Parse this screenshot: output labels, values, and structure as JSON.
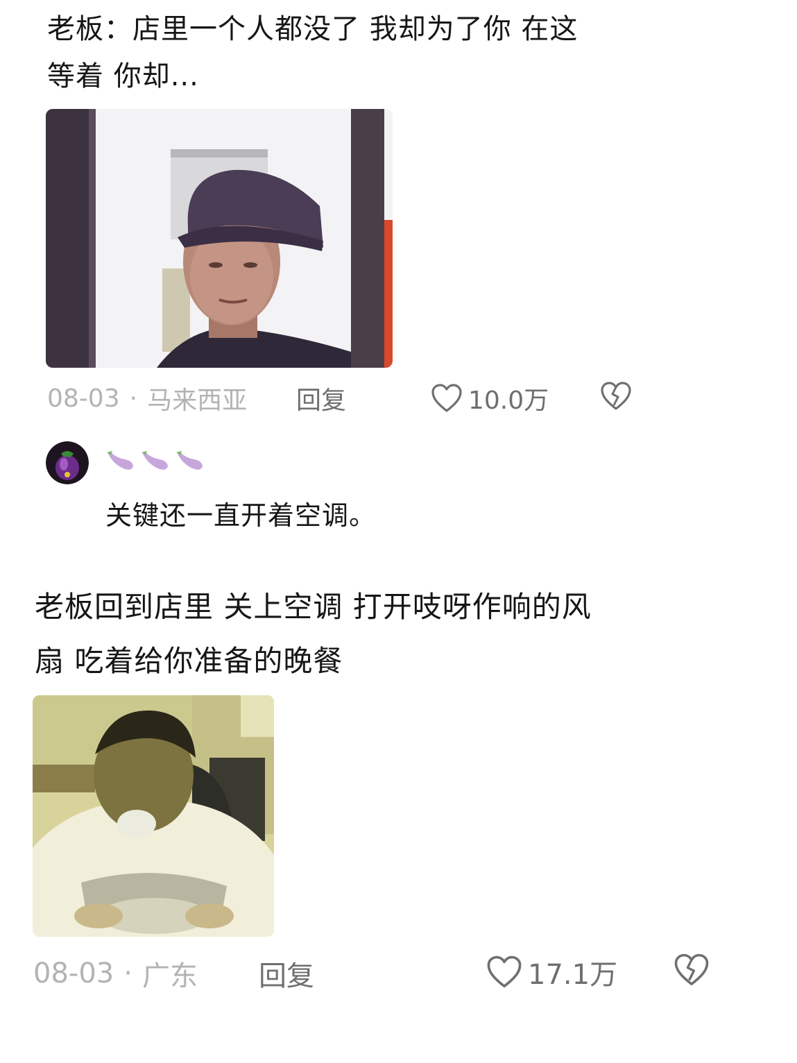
{
  "comments": [
    {
      "text_line1": "老板：店里一个人都没了 我却为了你 在这",
      "text_line2": "等着 你却...",
      "date": "08-03",
      "sep": "·",
      "location": "马来西亚",
      "reply_label": "回复",
      "likes": "10.0万",
      "reply": {
        "username_emoji": "🍆🍆🍆",
        "text": "关键还一直开着空调。"
      }
    },
    {
      "text_line1": "老板回到店里 关上空调 打开吱呀作响的风",
      "text_line2": "扇 吃着给你准备的晚餐",
      "date": "08-03",
      "sep": "·",
      "location": "广东",
      "reply_label": "回复",
      "likes": "17.1万"
    }
  ],
  "icons": {
    "like": "heart-outline-icon",
    "dislike": "broken-heart-icon"
  },
  "colors": {
    "meta_grey": "#b3b3b3",
    "action_grey": "#6f6f6f",
    "eggplant_purple": "#b68fd0"
  }
}
